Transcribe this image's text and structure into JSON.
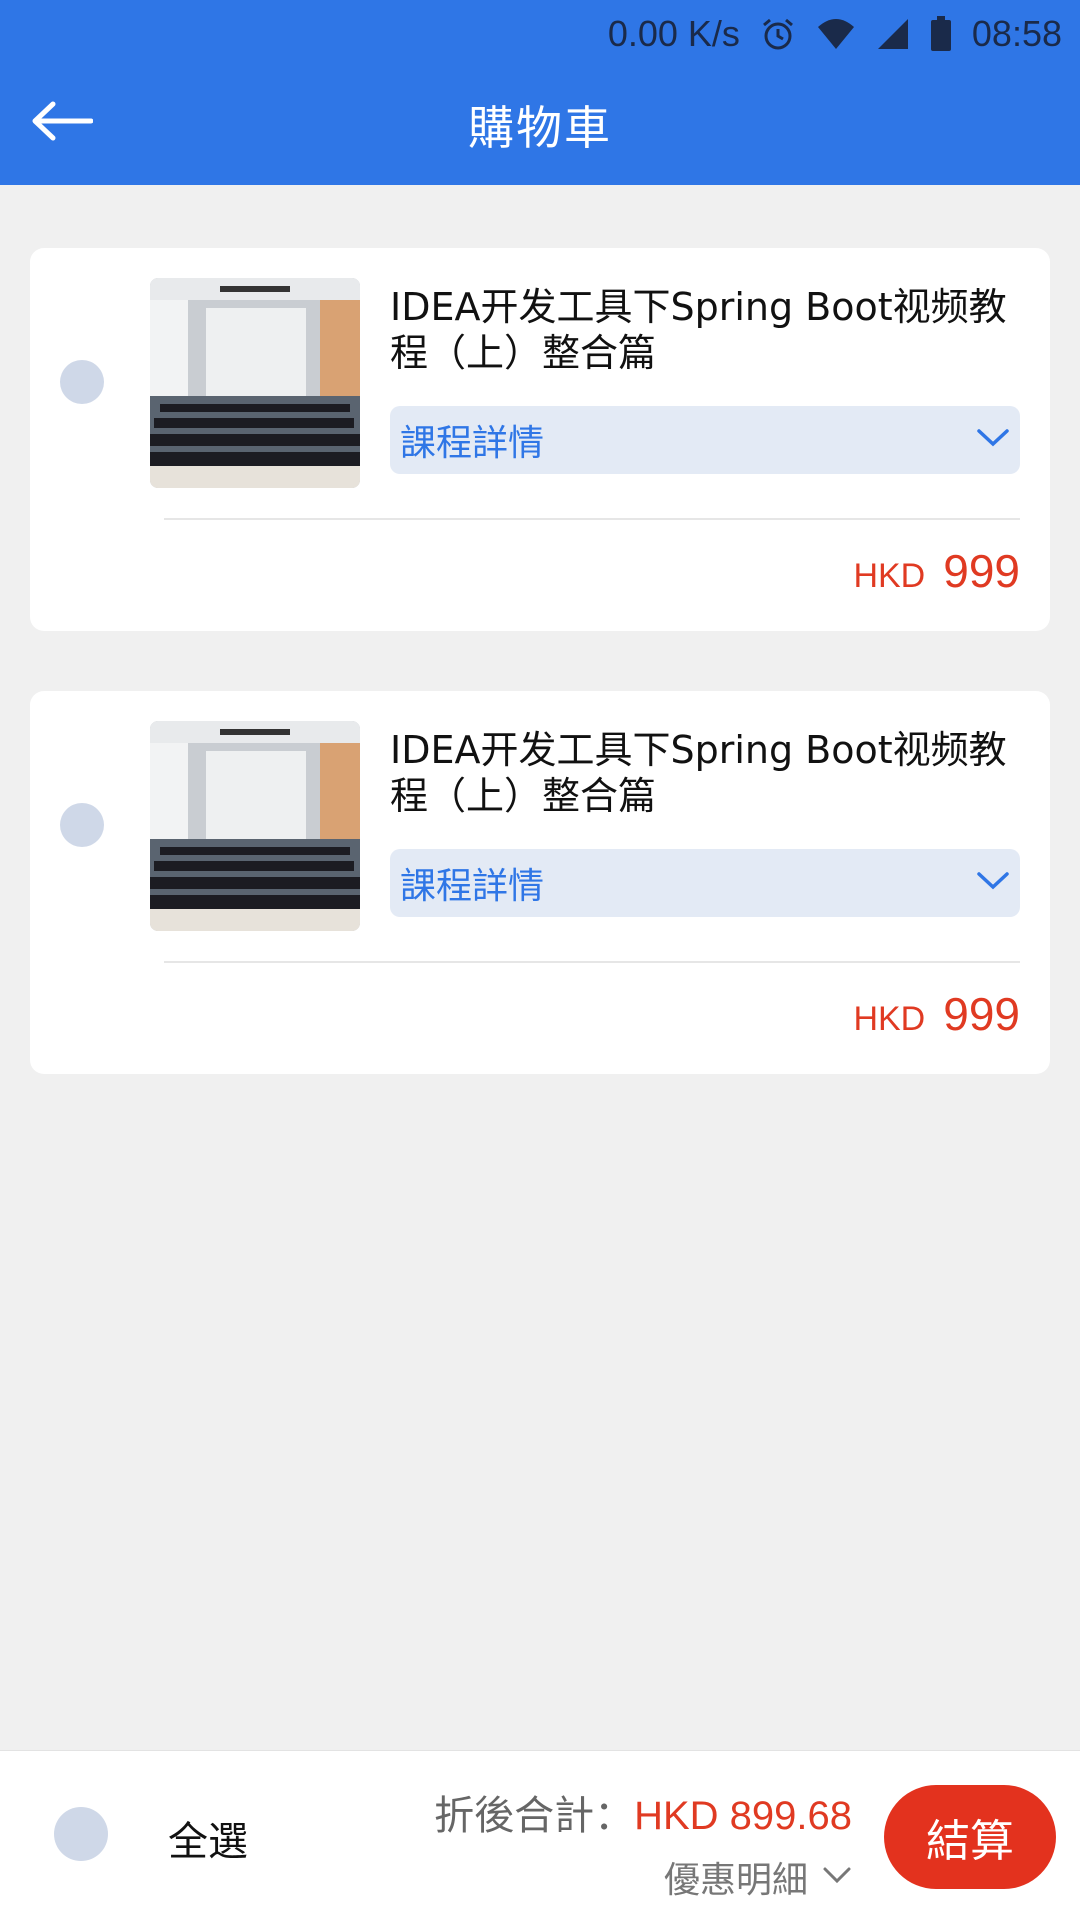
{
  "status_bar": {
    "net_speed": "0.00 K/s",
    "time": "08:58",
    "icons": [
      "alarm-icon",
      "wifi-icon",
      "signal-icon",
      "battery-icon"
    ]
  },
  "header": {
    "title": "購物車",
    "back_icon": "arrow-left-icon"
  },
  "cart": {
    "items": [
      {
        "title": "IDEA开发工具下Spring Boot视频教程（上）整合篇",
        "details_label": "課程詳情",
        "currency": "HKD",
        "price": "999"
      },
      {
        "title": "IDEA开发工具下Spring Boot视频教程（上）整合篇",
        "details_label": "課程詳情",
        "currency": "HKD",
        "price": "999"
      }
    ]
  },
  "footer": {
    "select_all_label": "全選",
    "total_label": "折後合計：",
    "total_value": "HKD 899.68",
    "discount_label": "優惠明細",
    "checkout_label": "結算"
  },
  "colors": {
    "primary": "#2f76e6",
    "price_red": "#e03a22",
    "radio_bg": "#cfd8e8"
  }
}
